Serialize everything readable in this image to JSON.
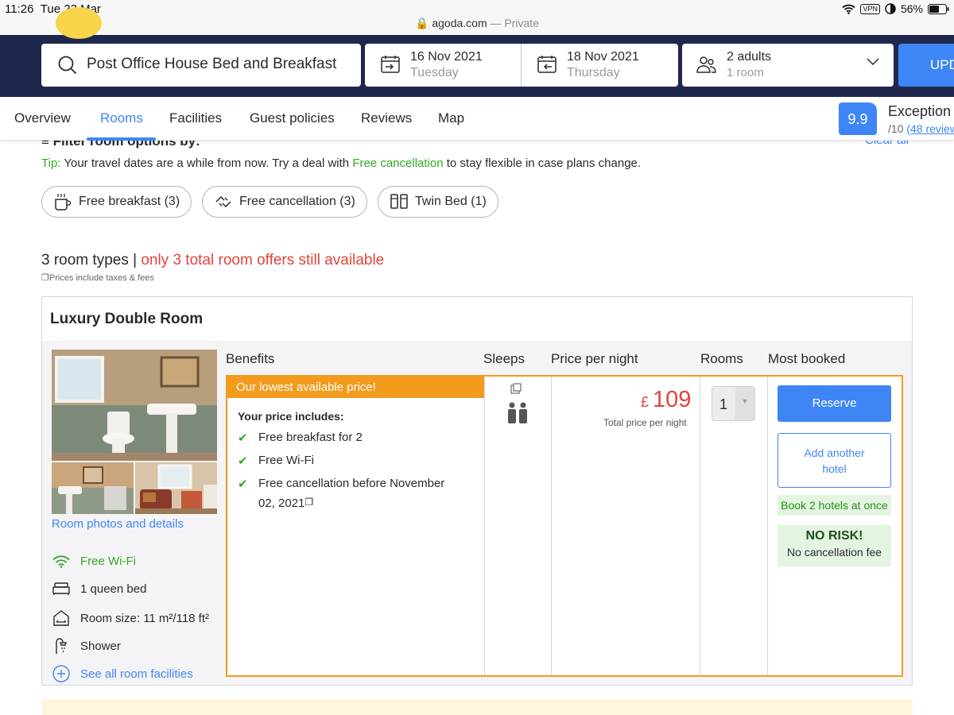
{
  "status_bar": {
    "time": "11:26",
    "date": "Tue 23 Mar",
    "url": "agoda.com",
    "privacy": "— Private",
    "vpn": "VPN",
    "battery": "56%"
  },
  "search": {
    "hotel": "Post Office House Bed and Breakfast",
    "checkin_date": "16 Nov 2021",
    "checkin_day": "Tuesday",
    "checkout_date": "18 Nov 2021",
    "checkout_day": "Thursday",
    "guests": "2 adults",
    "rooms": "1 room",
    "update_label": "UPD"
  },
  "tabs": [
    {
      "label": "Overview"
    },
    {
      "label": "Rooms"
    },
    {
      "label": "Facilities"
    },
    {
      "label": "Guest policies"
    },
    {
      "label": "Reviews"
    },
    {
      "label": "Map"
    }
  ],
  "rating": {
    "score": "9.9",
    "label": "Exception",
    "out_of": "/10",
    "reviews": "(48 review"
  },
  "filter": {
    "title": "Filter room options by:",
    "clear_all": "Clear all",
    "tip_label": "Tip:",
    "tip_text": "Your travel dates are a while from now. Try a deal with",
    "tip_highlight": "Free cancellation",
    "tip_tail": "to stay flexible in case plans change.",
    "chips": [
      {
        "label": "Free breakfast (3)"
      },
      {
        "label": "Free cancellation (3)"
      },
      {
        "label": "Twin Bed (1)"
      }
    ]
  },
  "summary": {
    "room_types": "3 room types",
    "separator": "|",
    "availability": "only 3 total room offers still available",
    "taxes": "Prices include taxes & fees"
  },
  "room": {
    "name": "Luxury Double Room",
    "photo_link": "Room photos and details",
    "features": [
      {
        "label": "Free Wi-Fi"
      },
      {
        "label": "1 queen bed"
      },
      {
        "label": "Room size: 11 m²/118 ft²"
      },
      {
        "label": "Shower"
      },
      {
        "label": "See all room facilities"
      }
    ],
    "columns": {
      "benefits": "Benefits",
      "sleeps": "Sleeps",
      "price": "Price per night",
      "rooms": "Rooms",
      "most_booked": "Most booked"
    },
    "offer": {
      "banner": "Our lowest available price!",
      "includes_title": "Your price includes:",
      "benefits": [
        {
          "label": "Free breakfast for 2"
        },
        {
          "label": "Free Wi-Fi"
        },
        {
          "label": "Free cancellation before November"
        }
      ],
      "benefit_cont": "02, 2021",
      "currency": "£",
      "price": "109",
      "price_note": "Total price per night",
      "quantity": "1",
      "reserve_label": "Reserve",
      "another_line1": "Add another",
      "another_line2": "hotel",
      "book2": "Book 2 hotels at once",
      "norisk_title": "NO RISK!",
      "norisk_sub": "No cancellation fee"
    }
  },
  "colors": {
    "nav_bg": "#20274d",
    "accent": "#3e86f5",
    "highlight": "#f29b1d",
    "alert": "#e2433d",
    "success": "#32a923"
  }
}
